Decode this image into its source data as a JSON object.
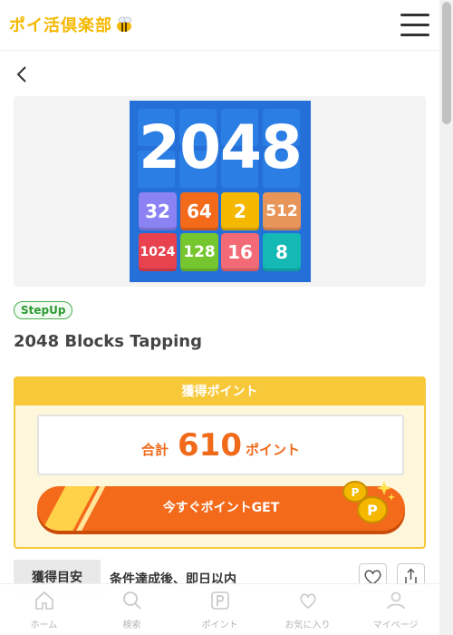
{
  "header": {
    "logo_text": "ポイ活倶楽部",
    "logo_icon": "bee-icon",
    "menu_icon": "hamburger-icon"
  },
  "navigation": {
    "back_icon": "chevron-left-icon"
  },
  "game_image": {
    "title": "2048",
    "tiles": [
      "32",
      "64",
      "2",
      "512",
      "1024",
      "128",
      "16",
      "8"
    ],
    "colors": {
      "background": "#2470d8",
      "t32": "#8b82f4",
      "t64": "#f36a1b",
      "t2": "#f5b800",
      "t512": "#e8955a",
      "t1024": "#e8424f",
      "t128": "#76c62f",
      "t16": "#f26a76",
      "t8": "#14b8b4"
    }
  },
  "app": {
    "badge": "StepUp",
    "title": "2048 Blocks Tapping"
  },
  "points": {
    "header": "獲得ポイント",
    "total_label": "合計",
    "total_value": "610",
    "unit": "ポイント",
    "cta_label": "今すぐポイントGET"
  },
  "info": {
    "label": "獲得目安",
    "value": "条件達成後、即日以内"
  },
  "actions": {
    "favorite_icon": "heart-icon",
    "share_icon": "share-icon"
  },
  "bottom_nav": [
    {
      "label": "ホーム",
      "icon": "home-icon"
    },
    {
      "label": "検索",
      "icon": "search-icon"
    },
    {
      "label": "ポイント",
      "icon": "point-icon"
    },
    {
      "label": "お気に入り",
      "icon": "heart-icon"
    },
    {
      "label": "マイページ",
      "icon": "user-icon"
    }
  ],
  "theme": {
    "accent": "#f36a1b",
    "yellow": "#f6c83a",
    "badge_green": "#4caf50"
  }
}
